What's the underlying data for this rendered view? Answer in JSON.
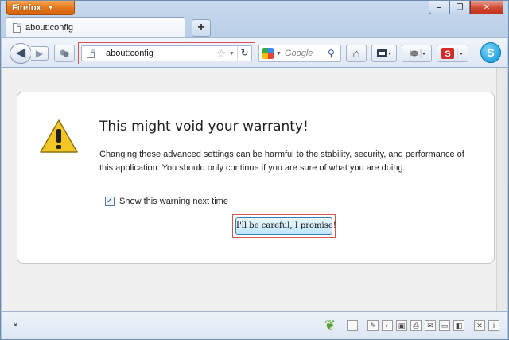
{
  "window": {
    "app_button_label": "Firefox",
    "app_button_caret": "▼",
    "minimize": "–",
    "maximize": "❐",
    "close": "✕"
  },
  "tabs": [
    {
      "label": "about:config"
    }
  ],
  "new_tab_label": "+",
  "navbar": {
    "back": "◀",
    "forward": "▶",
    "url": "about:config",
    "star": "☆",
    "url_dropdown": "▼",
    "reload": "↻",
    "search_placeholder": "Google",
    "search_dropdown": "▼",
    "search_go": "⚲",
    "home": "⌂",
    "skype": "S"
  },
  "dialog": {
    "title": "This might void your warranty!",
    "description": "Changing these advanced settings can be harmful to the stability, security, and performance of this application. You should only continue if you are sure of what you are doing.",
    "checkbox_label": "Show this warning next time",
    "checkbox_checked": true,
    "checkbox_mark": "✓",
    "confirm_button": "I'll be careful, I promise!"
  },
  "addon_bar": {
    "close": "×"
  },
  "colors": {
    "highlight_outline": "#d9534f",
    "warning_yellow": "#f3c623"
  }
}
